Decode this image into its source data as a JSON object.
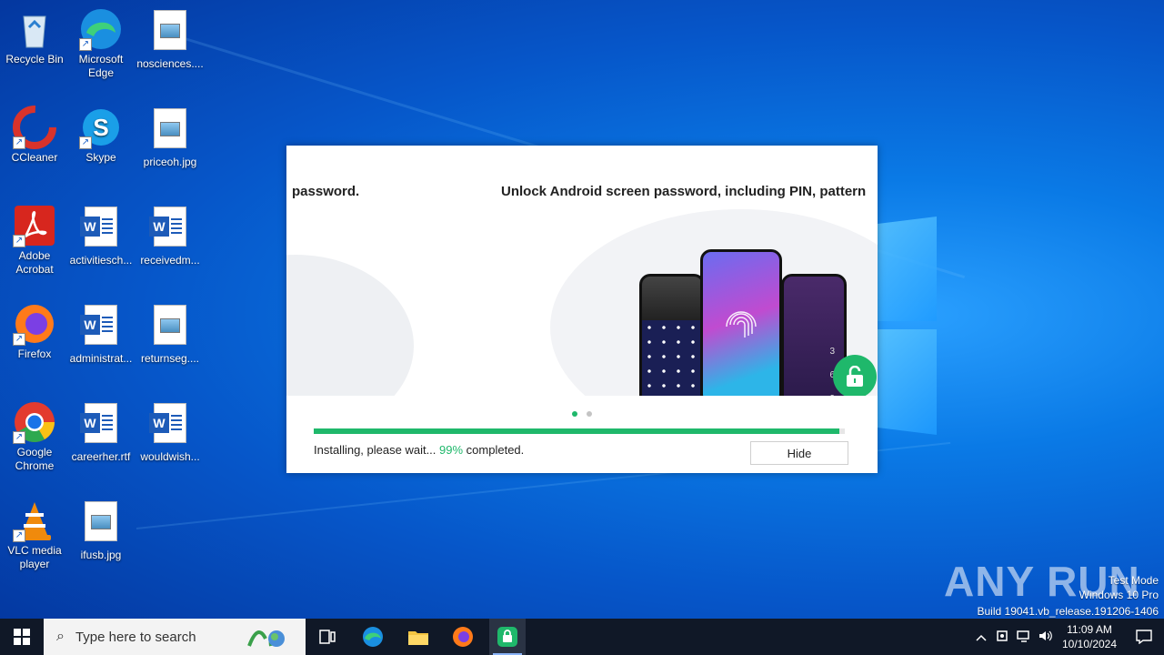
{
  "desktop": {
    "icons": [
      {
        "label": "Recycle Bin"
      },
      {
        "label": "Microsoft Edge"
      },
      {
        "label": "nosciences...."
      },
      {
        "label": "CCleaner"
      },
      {
        "label": "Skype"
      },
      {
        "label": "priceoh.jpg"
      },
      {
        "label": "Adobe Acrobat"
      },
      {
        "label": "activitiesch..."
      },
      {
        "label": "receivedm..."
      },
      {
        "label": "Firefox"
      },
      {
        "label": "administrat..."
      },
      {
        "label": "returnseg...."
      },
      {
        "label": "Google Chrome"
      },
      {
        "label": "careerher.rtf"
      },
      {
        "label": "wouldwish..."
      },
      {
        "label": "VLC media player"
      },
      {
        "label": "ifusb.jpg"
      }
    ]
  },
  "installer": {
    "slide_text_left": "password.",
    "slide_text_right": "Unlock Android screen password, including PIN, pattern",
    "status_prefix": "Installing, please wait... ",
    "progress_label": "99%",
    "progress_value": 0.99,
    "status_suffix": " completed.",
    "hide_label": "Hide",
    "dots": 2,
    "active_dot": 0
  },
  "watermark": {
    "logo": "ANY RUN",
    "mode": "Test Mode",
    "edition": "Windows 10 Pro",
    "build": "Build 19041.vb_release.191206-1406"
  },
  "taskbar": {
    "search_placeholder": "Type here to search",
    "time": "11:09 AM",
    "date": "10/10/2024"
  },
  "colors": {
    "accent_green": "#1fb86b",
    "taskbar": "#101827"
  }
}
